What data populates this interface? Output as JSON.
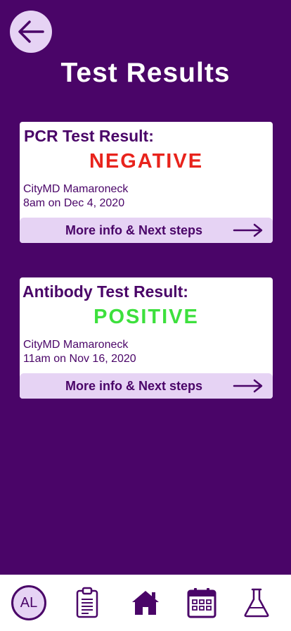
{
  "header": {
    "title": "Test Results"
  },
  "results": [
    {
      "heading": "PCR Test Result:",
      "result": "NEGATIVE",
      "result_color": "#e8231c",
      "location": "CityMD Mamaroneck",
      "time": "8am on Dec 4, 2020",
      "link_label": "More info & Next steps"
    },
    {
      "heading": "Antibody Test Result:",
      "result": "POSITIVE",
      "result_color": "#3de03d",
      "location": "CityMD Mamaroneck",
      "time": "11am on Nov 16, 2020",
      "link_label": "More info & Next steps"
    }
  ],
  "nav": {
    "avatar_initials": "AL",
    "items": [
      "avatar",
      "clipboard-icon",
      "home-icon",
      "calendar-icon",
      "flask-icon"
    ]
  },
  "colors": {
    "brand_purple": "#4a0568",
    "light_purple": "#e6d3f4",
    "negative_red": "#e8231c",
    "positive_green": "#3de03d"
  }
}
